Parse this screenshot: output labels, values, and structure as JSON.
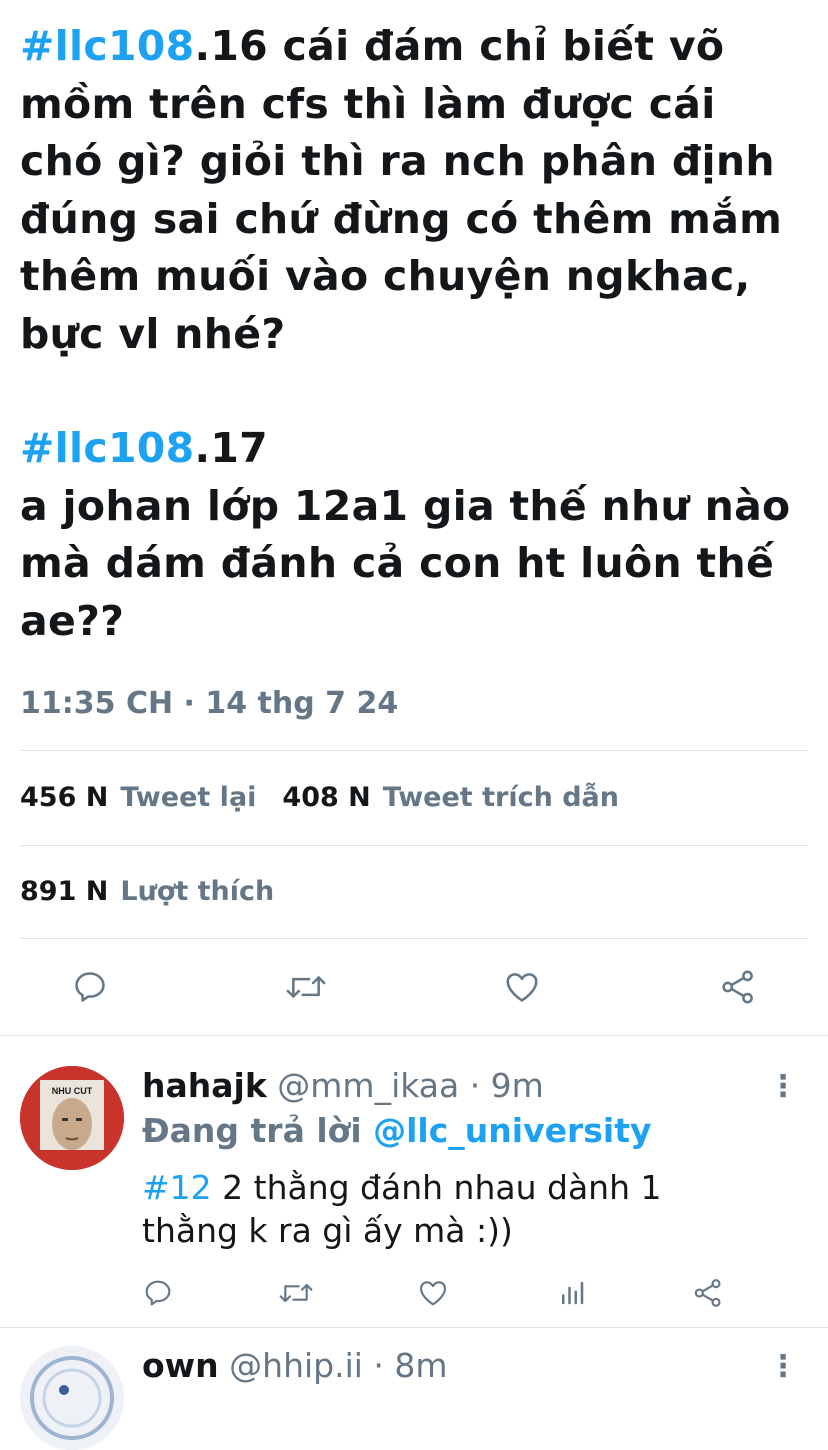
{
  "tweet": {
    "para1": {
      "hashtag": "#llc108",
      "text": ".16 cái đám chỉ biết võ mồm trên cfs thì làm được cái chó gì? giỏi thì ra nch phân định đúng sai chứ đừng có thêm mắm thêm muối vào chuyện ngkhac, bực vl nhé?"
    },
    "para2": {
      "hashtag": "#llc108",
      "text_line1": ".17",
      "text_rest": "a johan lớp 12a1 gia thế như nào mà dám đánh cả con ht luôn thế ae??"
    },
    "timestamp": "11:35 CH · 14 thg 7 24"
  },
  "stats": {
    "retweets_count": "456 N",
    "retweets_label": "Tweet lại",
    "quotes_count": "408 N",
    "quotes_label": "Tweet trích dẫn",
    "likes_count": "891 N",
    "likes_label": "Lượt thích"
  },
  "actions": [
    "reply-icon",
    "retweet-icon",
    "like-icon",
    "share-icon"
  ],
  "replies": [
    {
      "display_name": "hahajk",
      "handle": "@mm_ikaa · 9m",
      "replying_prefix": "Đang trả lời ",
      "replying_to": "@llc_university",
      "hashtag": "#12",
      "text": " 2 thằng đánh nhau dành 1 thằng k ra gì ấy mà :))",
      "avatar_caption": "NHU CUT",
      "more": "⋮"
    },
    {
      "display_name": "own",
      "handle": "@hhip.ii · 8m",
      "more": "⋮"
    }
  ],
  "colors": {
    "accent": "#1da1f2",
    "secondary": "#657786",
    "text": "#14171a",
    "divider": "#dfe3e6"
  }
}
